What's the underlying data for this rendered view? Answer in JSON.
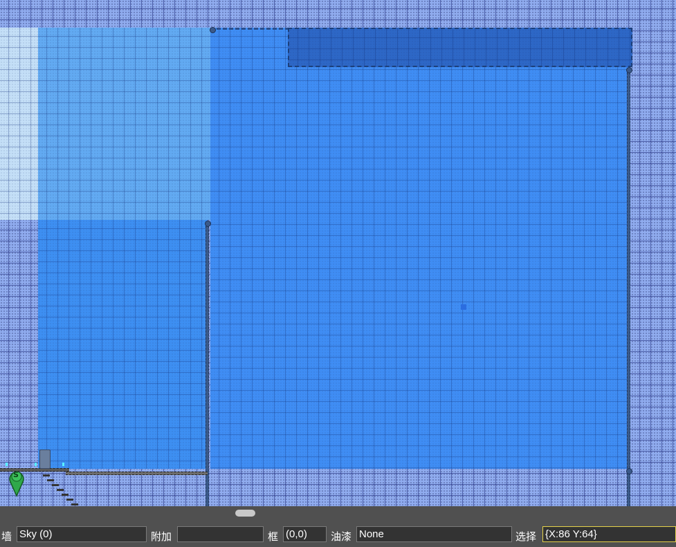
{
  "statusbar": {
    "wall": {
      "label": "墙",
      "value": "Sky (0)"
    },
    "extra": {
      "label": "附加",
      "value": ""
    },
    "frame": {
      "label": "框",
      "value": "(0,0)"
    },
    "paint": {
      "label": "油漆",
      "value": "None"
    },
    "selection": {
      "label": "选择",
      "value": "{X:86 Y:64}"
    }
  },
  "icons": {
    "spawn_marker": "spawn-point-pin-icon",
    "spawn_letter": "S"
  },
  "colors": {
    "background_grid": "#90acef",
    "room_light": "#62aaf2",
    "room_main": "#3f8df4",
    "room_pale": "#c4dff7",
    "header_band": "#2d67c6",
    "statusbar_bg": "#505050",
    "field_bg": "#333333",
    "selection_border": "#e6d34a",
    "spawn_green": "#2fa84a"
  }
}
